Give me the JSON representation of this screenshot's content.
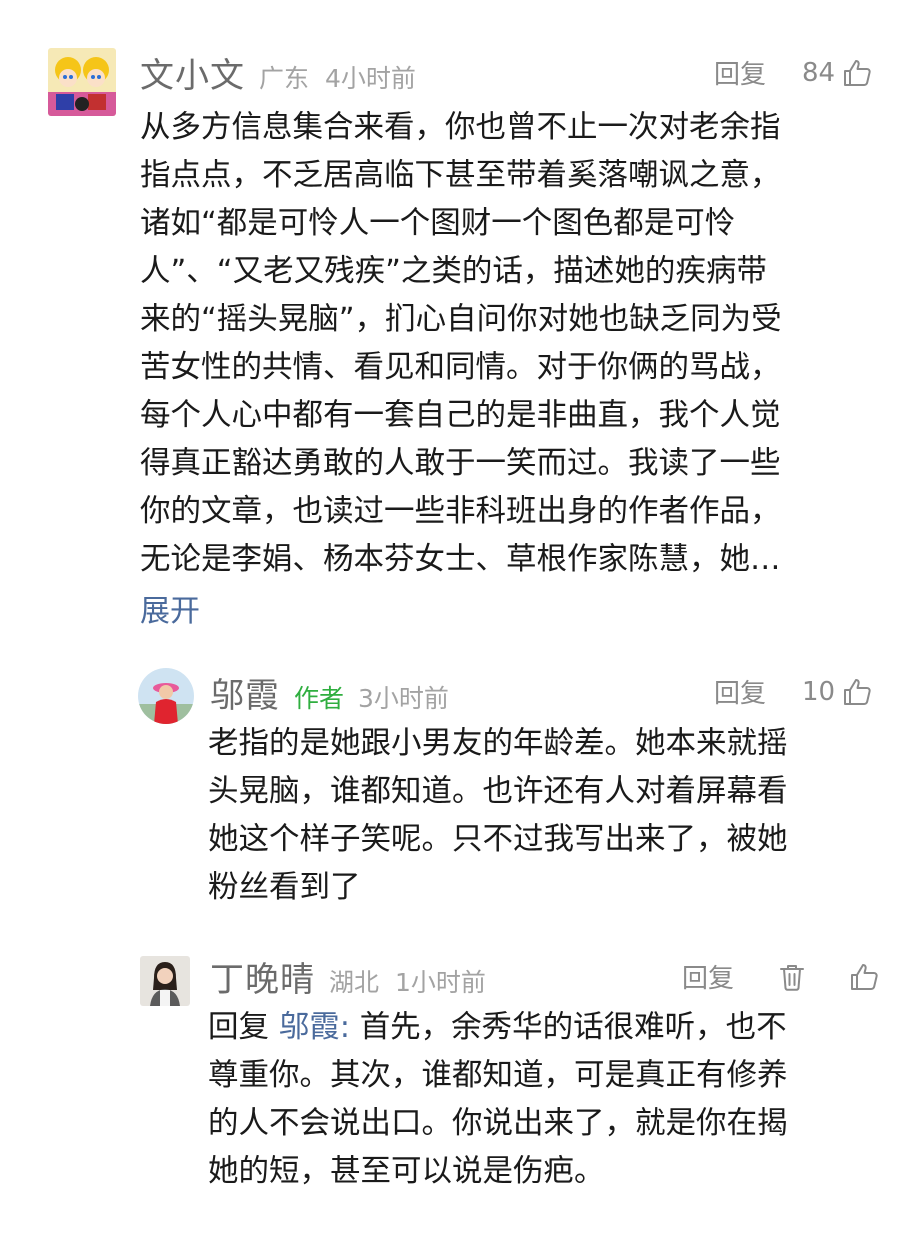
{
  "comments": [
    {
      "user": "文小文",
      "location": "广东",
      "time": "4小时前",
      "reply_label": "回复",
      "likes": "84",
      "lines": [
        "从多方信息集合来看，你也曾不止一次对老余指",
        "指点点，不乏居高临下甚至带着奚落嘲讽之意，",
        "诸如“都是可怜人一个图财一个图色都是可怜",
        "人”、“又老又残疾”之类的话，描述她的疾病带",
        "来的“摇头晃脑”，扪心自问你对她也缺乏同为受",
        "苦女性的共情、看见和同情。对于你俩的骂战，",
        "每个人心中都有一套自己的是非曲直，我个人觉",
        "得真正豁达勇敢的人敢于一笑而过。我读了一些",
        "你的文章，也读过一些非科班出身的作者作品，",
        "无论是李娟、杨本芬女士、草根作家陈慧，她…"
      ],
      "expand_label": "展开"
    },
    {
      "user": "邬霞",
      "badge": "作者",
      "time": "3小时前",
      "reply_label": "回复",
      "likes": "10",
      "lines": [
        "老指的是她跟小男友的年龄差。她本来就摇",
        "头晃脑，谁都知道。也许还有人对着屏幕看",
        "她这个样子笑呢。只不过我写出来了，被她",
        "粉丝看到了"
      ]
    },
    {
      "user": "丁晚晴",
      "location": "湖北",
      "time": "1小时前",
      "reply_label": "回复",
      "reply_prefix": "回复",
      "reply_to": "邬霞:",
      "first_line_rest": "首先，余秀华的话很难听，也不",
      "lines": [
        "尊重你。其次，谁都知道，可是真正有修养",
        "的人不会说出口。你说出来了，就是你在揭",
        "她的短，甚至可以说是伤疤。"
      ]
    }
  ],
  "icons": {
    "like": "thumbs-up-icon",
    "delete": "trash-icon"
  },
  "colors": {
    "author_badge": "#2fae3f",
    "link": "#4a6a9c",
    "meta": "#a3a3a3"
  }
}
